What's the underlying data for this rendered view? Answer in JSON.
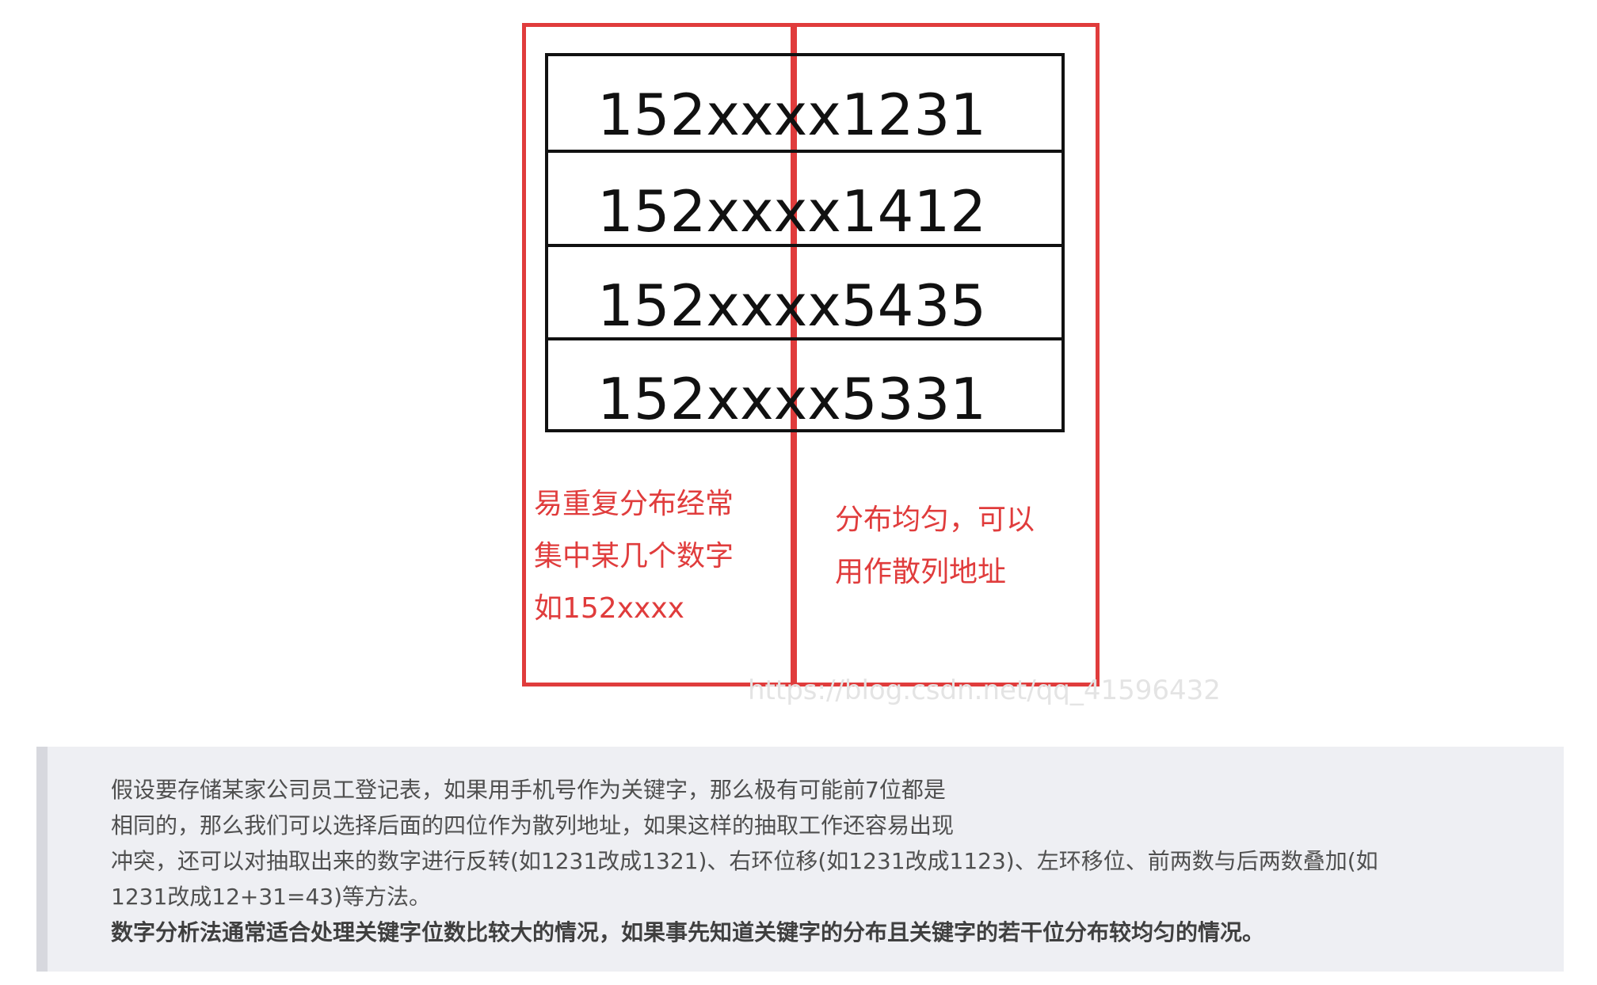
{
  "figure": {
    "rows": [
      "152xxxx1231",
      "152xxxx1412",
      "152xxxx5435",
      "152xxxx5331"
    ],
    "left_note": [
      "易重复分布经常",
      "集中某几个数字",
      "如152xxxx"
    ],
    "right_note": [
      "分布均匀，可以",
      "用作散列地址"
    ],
    "watermark": "https://blog.csdn.net/qq_41596432",
    "colors": {
      "accent_red": "#e03c3c",
      "table_border": "#111111"
    }
  },
  "quote": {
    "lines": [
      "假设要存储某家公司员工登记表，如果用手机号作为关键字，那么极有可能前7位都是",
      "相同的，那么我们可以选择后面的四位作为散列地址，如果这样的抽取工作还容易出现",
      "冲突，还可以对抽取出来的数字进行反转(如1231改成1321)、右环位移(如1231改成1123)、左环移位、前两数与后两数叠加(如",
      "1231改成12+31=43)等方法。"
    ],
    "bold_line": "数字分析法通常适合处理关键字位数比较大的情况，如果事先知道关键字的分布且关键字的若干位分布较均匀的情况。",
    "colors": {
      "background": "#eeeff3",
      "left_bar": "#d7d8de"
    }
  }
}
